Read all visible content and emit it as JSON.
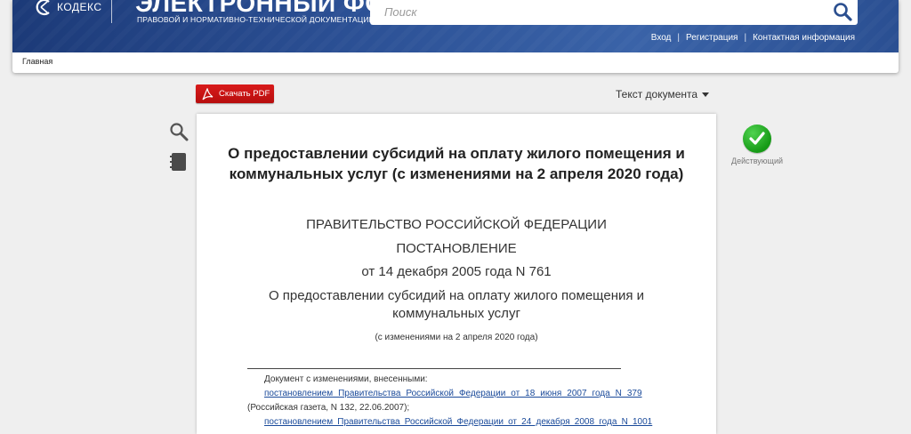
{
  "header": {
    "brand": "КОДЕКС",
    "title": "ЭЛЕКТРОННЫЙ ФОНД",
    "subtitle": "ПРАВОВОЙ И НОРМАТИВНО-ТЕХНИЧЕСКОЙ ДОКУМЕНТАЦИИ",
    "search_placeholder": "Поиск",
    "links": {
      "login": "Вход",
      "register": "Регистрация",
      "contacts": "Контактная информация"
    },
    "separator": "|"
  },
  "breadcrumb": {
    "home": "Главная"
  },
  "toolbar": {
    "pdf_label": "Скачать PDF",
    "view_label": "Текст документа"
  },
  "status": {
    "label": "Действующий",
    "color": "#1fae1f"
  },
  "document": {
    "title": "О предоставлении субсидий на оплату жилого помещения и коммунальных услуг (с изменениями на 2 апреля 2020 года)",
    "authority": "ПРАВИТЕЛЬСТВО РОССИЙСКОЙ ФЕДЕРАЦИИ",
    "doc_type": "ПОСТАНОВЛЕНИЕ",
    "date_number": "от 14 декабря 2005 года N 761",
    "subject": "О предоставлении субсидий на оплату жилого помещения и коммунальных услуг",
    "revision": "(с изменениями на 2 апреля 2020 года)",
    "changes_intro": "Документ с изменениями, внесенными:",
    "change_1_link": "постановлением Правительства Российской Федерации от 18 июня 2007 года N 379",
    "change_1_source": "(Российская газета, N 132, 22.06.2007);",
    "change_2_link": "постановлением Правительства Российской Федерации от 24 декабря 2008 года N 1001"
  },
  "colors": {
    "banner": "#2c5196",
    "pdf_button": "#c81414",
    "link": "#1a4a9a"
  }
}
